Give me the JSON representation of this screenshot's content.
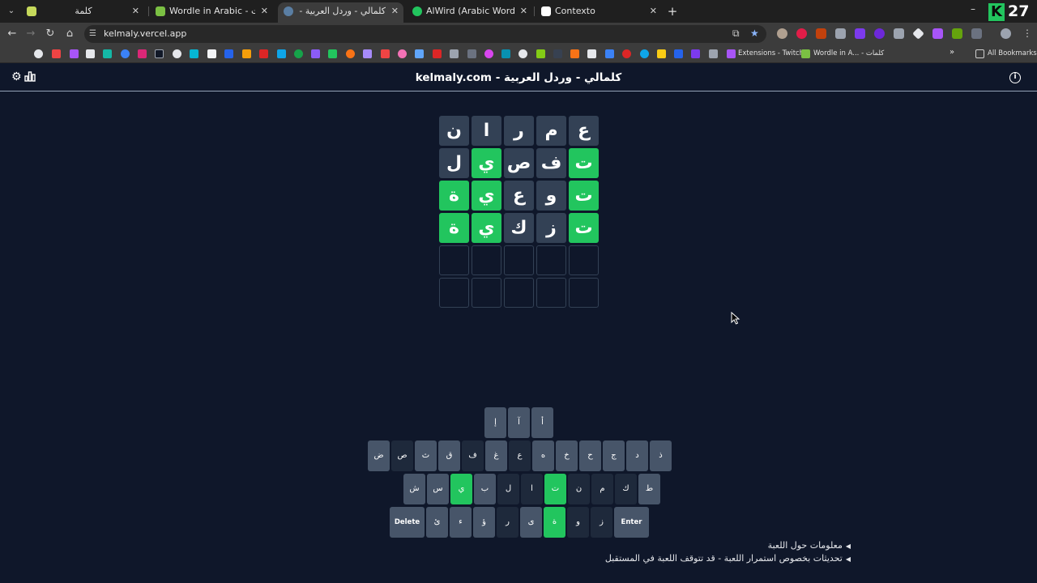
{
  "browser": {
    "tabs": [
      {
        "title": "كلمة",
        "color": "#c6d95b"
      },
      {
        "title": "Wordle in Arabic - كلمات",
        "color": "#7bc043"
      },
      {
        "title": "كلمالي - وردل العربية - kelmaly.com",
        "color": "#5a7ea3"
      },
      {
        "title": "AlWird (Arabic Wordle) - الورد",
        "color": "#22c55e"
      },
      {
        "title": "Contexto",
        "color": "#ffffff"
      }
    ],
    "url": "kelmaly.vercel.app",
    "counter": "27",
    "bookmarks": {
      "twitch_label": "Extensions - Twitch",
      "wordle_label": "Wordle in A... - كلمات",
      "all_label": "All Bookmarks"
    }
  },
  "header": {
    "title": "kelmaly.com - كلمالي - وردل العربية"
  },
  "board": {
    "rows": [
      [
        {
          "l": "ع",
          "s": "absent"
        },
        {
          "l": "م",
          "s": "absent"
        },
        {
          "l": "ر",
          "s": "absent"
        },
        {
          "l": "ا",
          "s": "absent"
        },
        {
          "l": "ن",
          "s": "absent"
        }
      ],
      [
        {
          "l": "ت",
          "s": "correct"
        },
        {
          "l": "ف",
          "s": "absent"
        },
        {
          "l": "ص",
          "s": "absent"
        },
        {
          "l": "ي",
          "s": "correct"
        },
        {
          "l": "ل",
          "s": "absent"
        }
      ],
      [
        {
          "l": "ت",
          "s": "correct"
        },
        {
          "l": "و",
          "s": "absent"
        },
        {
          "l": "ع",
          "s": "absent"
        },
        {
          "l": "ي",
          "s": "correct"
        },
        {
          "l": "ة",
          "s": "correct"
        }
      ],
      [
        {
          "l": "ت",
          "s": "correct"
        },
        {
          "l": "ز",
          "s": "absent"
        },
        {
          "l": "ك",
          "s": "absent"
        },
        {
          "l": "ي",
          "s": "correct"
        },
        {
          "l": "ة",
          "s": "correct"
        }
      ],
      [
        {
          "l": "",
          "s": "empty"
        },
        {
          "l": "",
          "s": "empty"
        },
        {
          "l": "",
          "s": "empty"
        },
        {
          "l": "",
          "s": "empty"
        },
        {
          "l": "",
          "s": "empty"
        }
      ],
      [
        {
          "l": "",
          "s": "empty"
        },
        {
          "l": "",
          "s": "empty"
        },
        {
          "l": "",
          "s": "empty"
        },
        {
          "l": "",
          "s": "empty"
        },
        {
          "l": "",
          "s": "empty"
        }
      ]
    ]
  },
  "keyboard": {
    "rows": [
      [
        {
          "k": "أ",
          "s": "default"
        },
        {
          "k": "آ",
          "s": "default"
        },
        {
          "k": "إ",
          "s": "default"
        }
      ],
      [
        {
          "k": "ذ",
          "s": "default"
        },
        {
          "k": "د",
          "s": "default"
        },
        {
          "k": "ج",
          "s": "default"
        },
        {
          "k": "ح",
          "s": "default"
        },
        {
          "k": "خ",
          "s": "default"
        },
        {
          "k": "ه",
          "s": "default"
        },
        {
          "k": "ع",
          "s": "absent"
        },
        {
          "k": "غ",
          "s": "default"
        },
        {
          "k": "ف",
          "s": "absent"
        },
        {
          "k": "ق",
          "s": "default"
        },
        {
          "k": "ث",
          "s": "default"
        },
        {
          "k": "ص",
          "s": "absent"
        },
        {
          "k": "ض",
          "s": "default"
        }
      ],
      [
        {
          "k": "ط",
          "s": "default"
        },
        {
          "k": "ك",
          "s": "absent"
        },
        {
          "k": "م",
          "s": "absent"
        },
        {
          "k": "ن",
          "s": "absent"
        },
        {
          "k": "ت",
          "s": "correct"
        },
        {
          "k": "ا",
          "s": "absent"
        },
        {
          "k": "ل",
          "s": "absent"
        },
        {
          "k": "ب",
          "s": "default"
        },
        {
          "k": "ي",
          "s": "correct"
        },
        {
          "k": "س",
          "s": "default"
        },
        {
          "k": "ش",
          "s": "default"
        }
      ],
      [
        {
          "k": "Enter",
          "s": "default"
        },
        {
          "k": "ز",
          "s": "absent"
        },
        {
          "k": "و",
          "s": "absent"
        },
        {
          "k": "ة",
          "s": "correct"
        },
        {
          "k": "ى",
          "s": "default"
        },
        {
          "k": "ر",
          "s": "absent"
        },
        {
          "k": "ؤ",
          "s": "default"
        },
        {
          "k": "ء",
          "s": "default"
        },
        {
          "k": "ئ",
          "s": "default"
        },
        {
          "k": "Delete",
          "s": "default"
        }
      ]
    ]
  },
  "footer": {
    "about": "معلومات حول اللعبة",
    "updates": "تحديثات بخصوص استمرار اللعبة - قد تتوقف اللعبة في المستقبل"
  },
  "colors": {
    "background": "#0f172a",
    "absent": "#334155",
    "correct": "#22c55e",
    "key_default": "#475569"
  }
}
